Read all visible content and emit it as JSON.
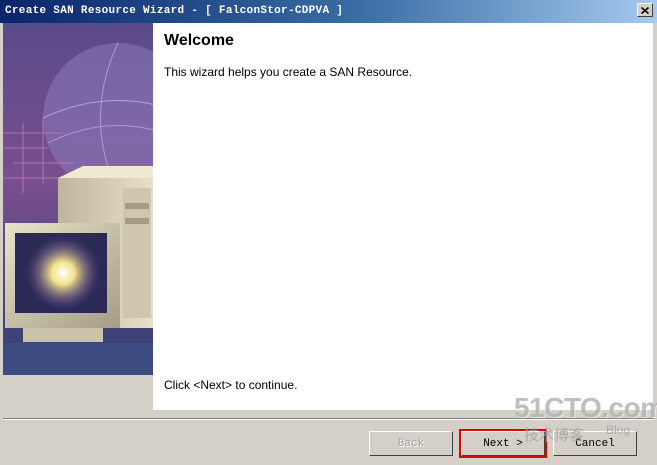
{
  "window": {
    "title": "Create SAN Resource Wizard - [ FalconStor-CDPVA ]"
  },
  "content": {
    "heading": "Welcome",
    "description": "This wizard helps you create a SAN Resource.",
    "continue_hint": "Click <Next> to continue."
  },
  "buttons": {
    "back": "Back",
    "next": "Next >",
    "cancel": "Cancel"
  },
  "watermark": {
    "site": "51CTO.com",
    "subtitle": "技术博客",
    "blog": "Blog"
  },
  "colors": {
    "titlebar_start": "#0a246a",
    "titlebar_end": "#a6caf0",
    "dialog_bg": "#d4d0c8",
    "highlight": "#e00000"
  },
  "icons": {
    "close": "close-icon"
  }
}
